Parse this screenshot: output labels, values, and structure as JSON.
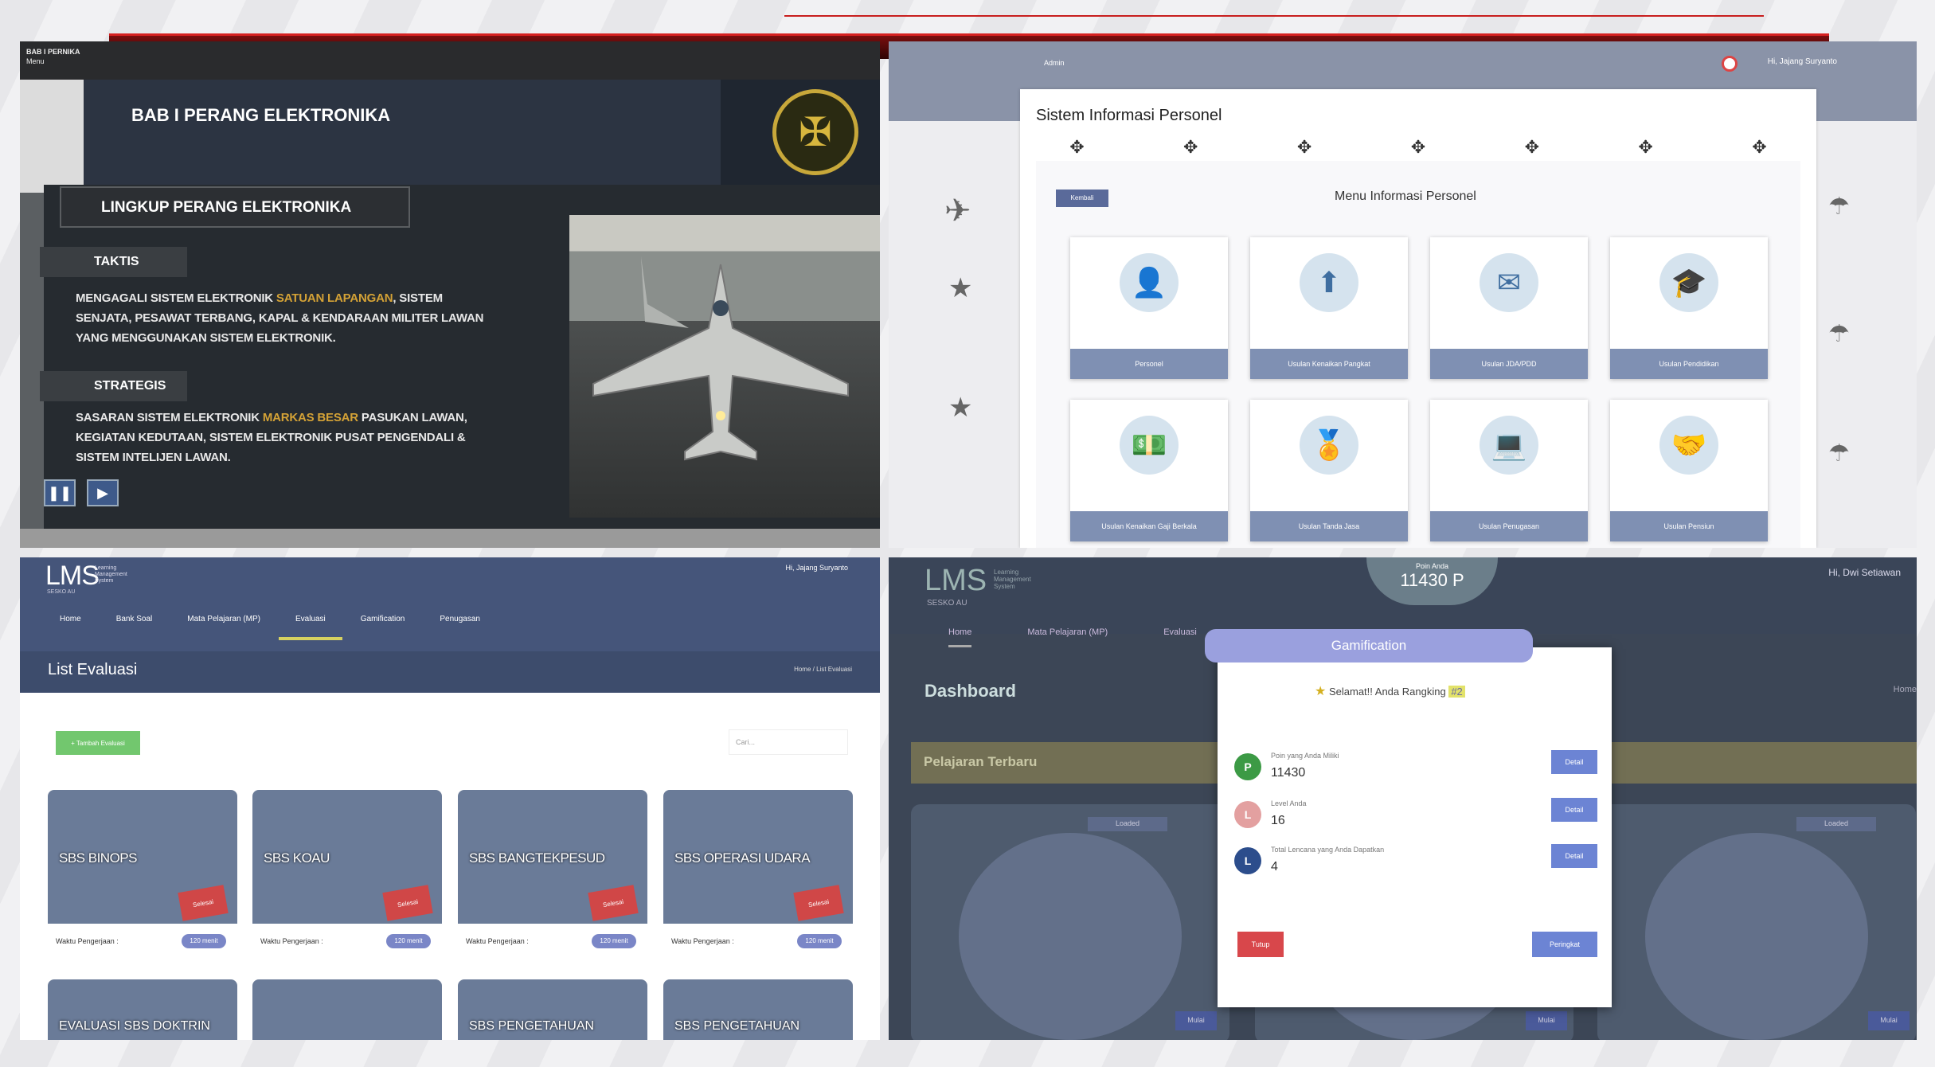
{
  "q1": {
    "window_title": "BAB I PERNIKA",
    "menu_label": "Menu",
    "banner_title": "BAB I PERANG ELEKTRONIKA",
    "section_heading": "LINGKUP PERANG ELEKTRONIKA",
    "taktis": {
      "label": "TAKTIS",
      "text_before": "MENGAGALI SISTEM ELEKTRONIK ",
      "highlight": "SATUAN LAPANGAN",
      "text_after": ", SISTEM SENJATA, PESAWAT TERBANG, KAPAL & KENDARAAN MILITER LAWAN YANG MENGGUNAKAN SISTEM ELEKTRONIK."
    },
    "strategis": {
      "label": "STRATEGIS",
      "text_before": "SASARAN SISTEM ELEKTRONIK ",
      "highlight": "MARKAS BESAR",
      "text_after": " PASUKAN LAWAN, KEGIATAN KEDUTAAN, SISTEM ELEKTRONIK PUSAT PENGENDALI & SISTEM INTELIJEN LAWAN."
    },
    "icons": {
      "pause": "pause-icon",
      "play": "play-icon",
      "emblem": "air-force-emblem"
    },
    "colors": {
      "highlight": "#d4a236",
      "control": "#3e5a8a"
    }
  },
  "q2": {
    "admin_label": "Admin",
    "user_greeting": "Hi, Jajang Suryanto",
    "card_title": "Sistem Informasi Personel",
    "back_button": "Kembali",
    "menu_title": "Menu Informasi Personel",
    "tiles": [
      {
        "label": "Personel",
        "icon": "person-icon"
      },
      {
        "label": "Usulan Kenaikan Pangkat",
        "icon": "rank-up-icon"
      },
      {
        "label": "Usulan JDA/PDD",
        "icon": "mail-icon"
      },
      {
        "label": "Usulan Pendidikan",
        "icon": "graduation-icon"
      },
      {
        "label": "Usulan Kenaikan Gaji Berkala",
        "icon": "money-chart-icon"
      },
      {
        "label": "Usulan Tanda Jasa",
        "icon": "medal-icon"
      },
      {
        "label": "Usulan Penugasan",
        "icon": "assignment-icon"
      },
      {
        "label": "Usulan Pensiun",
        "icon": "handshake-icon"
      }
    ],
    "colors": {
      "tile_label": "#7f90b3"
    }
  },
  "q3": {
    "logo": "LMS",
    "logo_sub": "Learning Management System",
    "org": "SESKO AU",
    "user": "Hi, Jajang Suryanto",
    "menu": [
      "Home",
      "Bank Soal",
      "Mata Pelajaran (MP)",
      "Evaluasi",
      "Gamification",
      "Penugasan"
    ],
    "active_menu": "Evaluasi",
    "page_title": "List Evaluasi",
    "breadcrumb": "Home / List Evaluasi",
    "add_button": "+ Tambah Evaluasi",
    "search_placeholder": "Cari...",
    "cards": [
      {
        "name": "SBS BINOPS",
        "tag": "Selesai",
        "label": "Waktu Pengerjaan :",
        "badge": "120 menit"
      },
      {
        "name": "SBS KOAU",
        "tag": "Selesai",
        "label": "Waktu Pengerjaan :",
        "badge": "120 menit"
      },
      {
        "name": "SBS BANGTEKPESUD",
        "tag": "Selesai",
        "label": "Waktu Pengerjaan :",
        "badge": "120 menit"
      },
      {
        "name": "SBS OPERASI UDARA",
        "tag": "Selesai",
        "label": "Waktu Pengerjaan :",
        "badge": "120 menit"
      }
    ],
    "cards_row2": [
      "EVALUASI SBS DOKTRIN",
      "SBS PENGETAHUAN",
      "SBS PENGETAHUAN"
    ]
  },
  "q4": {
    "logo": "LMS",
    "logo_sub": "Learning Management System",
    "org": "SESKO AU",
    "poin_label": "Poin Anda",
    "poin_value": "11430 P",
    "user": "Hi, Dwi Setiawan",
    "nav": [
      "Home",
      "Mata Pelajaran (MP)",
      "Evaluasi"
    ],
    "dashboard": "Dashboard",
    "home_link": "Home",
    "section": "Pelajaran Terbaru",
    "modal": {
      "title": "Gamification",
      "congrats": "Selamat!! Anda Rangking",
      "rank": "#2",
      "rows": [
        {
          "circle": "P",
          "label": "Poin yang Anda Miliki",
          "value": "11430",
          "button": "Detail",
          "color": "#3c9a45"
        },
        {
          "circle": "L",
          "label": "Level Anda",
          "value": "16",
          "button": "Detail",
          "color": "#e3a0a0"
        },
        {
          "circle": "L",
          "label": "Total Lencana yang Anda Dapatkan",
          "value": "4",
          "button": "Detail",
          "color": "#2c4d8c"
        }
      ],
      "close": "Tutup",
      "ranking": "Peringkat"
    },
    "mulai": "Mulai",
    "card_badge": "Loaded"
  }
}
